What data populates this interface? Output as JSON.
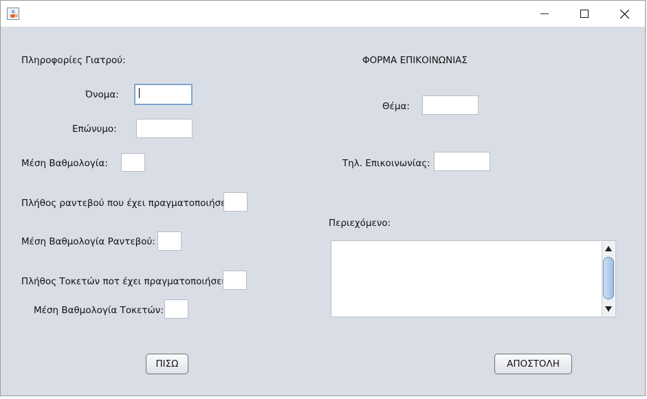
{
  "left": {
    "section_title": "Πληροφορίες Γιατρού:",
    "first_name_label": "Όνομα:",
    "last_name_label": "Επώνυμο:",
    "avg_rating_label": "Μέση Βαθμολογία:",
    "appointments_count_label": "Πλήθος ραντεβού που έχει πραγματοποιήσει:",
    "appointments_rating_label": "Μέση Βαθμολογία Ραντεβού:",
    "births_count_label": "Πλήθος Τοκετών ποτ έχει πραγματοποιήσει:",
    "births_rating_label": "Μέση Βαθμολογία Τοκετών:",
    "back_button": "ΠΙΣΩ"
  },
  "right": {
    "section_title": "ΦΟΡΜΑ ΕΠΙΚΟΙΝΩΝΙΑΣ",
    "subject_label": "Θέμα:",
    "phone_label": "Τηλ. Επικοινωνίας:",
    "content_label": "Περιεχόμενο:",
    "send_button": "ΑΠΟΣΤΟΛΗ"
  },
  "icons": {
    "app": "java-coffee-icon",
    "minimize": "minimize-icon",
    "maximize": "maximize-icon",
    "close": "close-icon",
    "scroll_up": "scroll-up-icon",
    "scroll_down": "scroll-down-icon"
  },
  "colors": {
    "panel_bg": "#d9dde5",
    "focus_border": "#7fa3cf"
  }
}
